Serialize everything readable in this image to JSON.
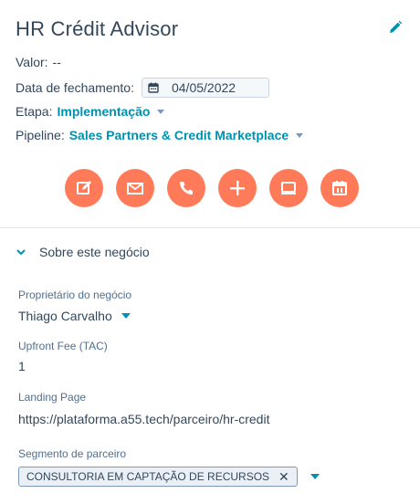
{
  "record": {
    "title": "HR Crédit Advisor",
    "valor_label": "Valor:",
    "valor_value": "--",
    "data_label": "Data de fechamento:",
    "data_value": "04/05/2022",
    "etapa_label": "Etapa:",
    "etapa_value": "Implementação",
    "pipeline_label": "Pipeline:",
    "pipeline_value": "Sales Partners & Credit Marketplace"
  },
  "actions": [
    {
      "name": "note-icon"
    },
    {
      "name": "email-icon"
    },
    {
      "name": "call-icon"
    },
    {
      "name": "add-icon"
    },
    {
      "name": "meeting-icon"
    },
    {
      "name": "task-icon"
    }
  ],
  "section": {
    "title": "Sobre este negócio"
  },
  "properties": {
    "owner_label": "Proprietário do negócio",
    "owner_value": "Thiago Carvalho",
    "fee_label": "Upfront Fee (TAC)",
    "fee_value": "1",
    "landing_label": "Landing Page",
    "landing_value": "https://plataforma.a55.tech/parceiro/hr-credit",
    "segment_label": "Segmento de parceiro",
    "segment_tag": "CONSULTORIA EM CAPTAÇÃO DE RECURSOS",
    "segment_remove": "✕"
  },
  "colors": {
    "accent": "#ff7a59",
    "link": "#0091ae",
    "text": "#33475b"
  }
}
